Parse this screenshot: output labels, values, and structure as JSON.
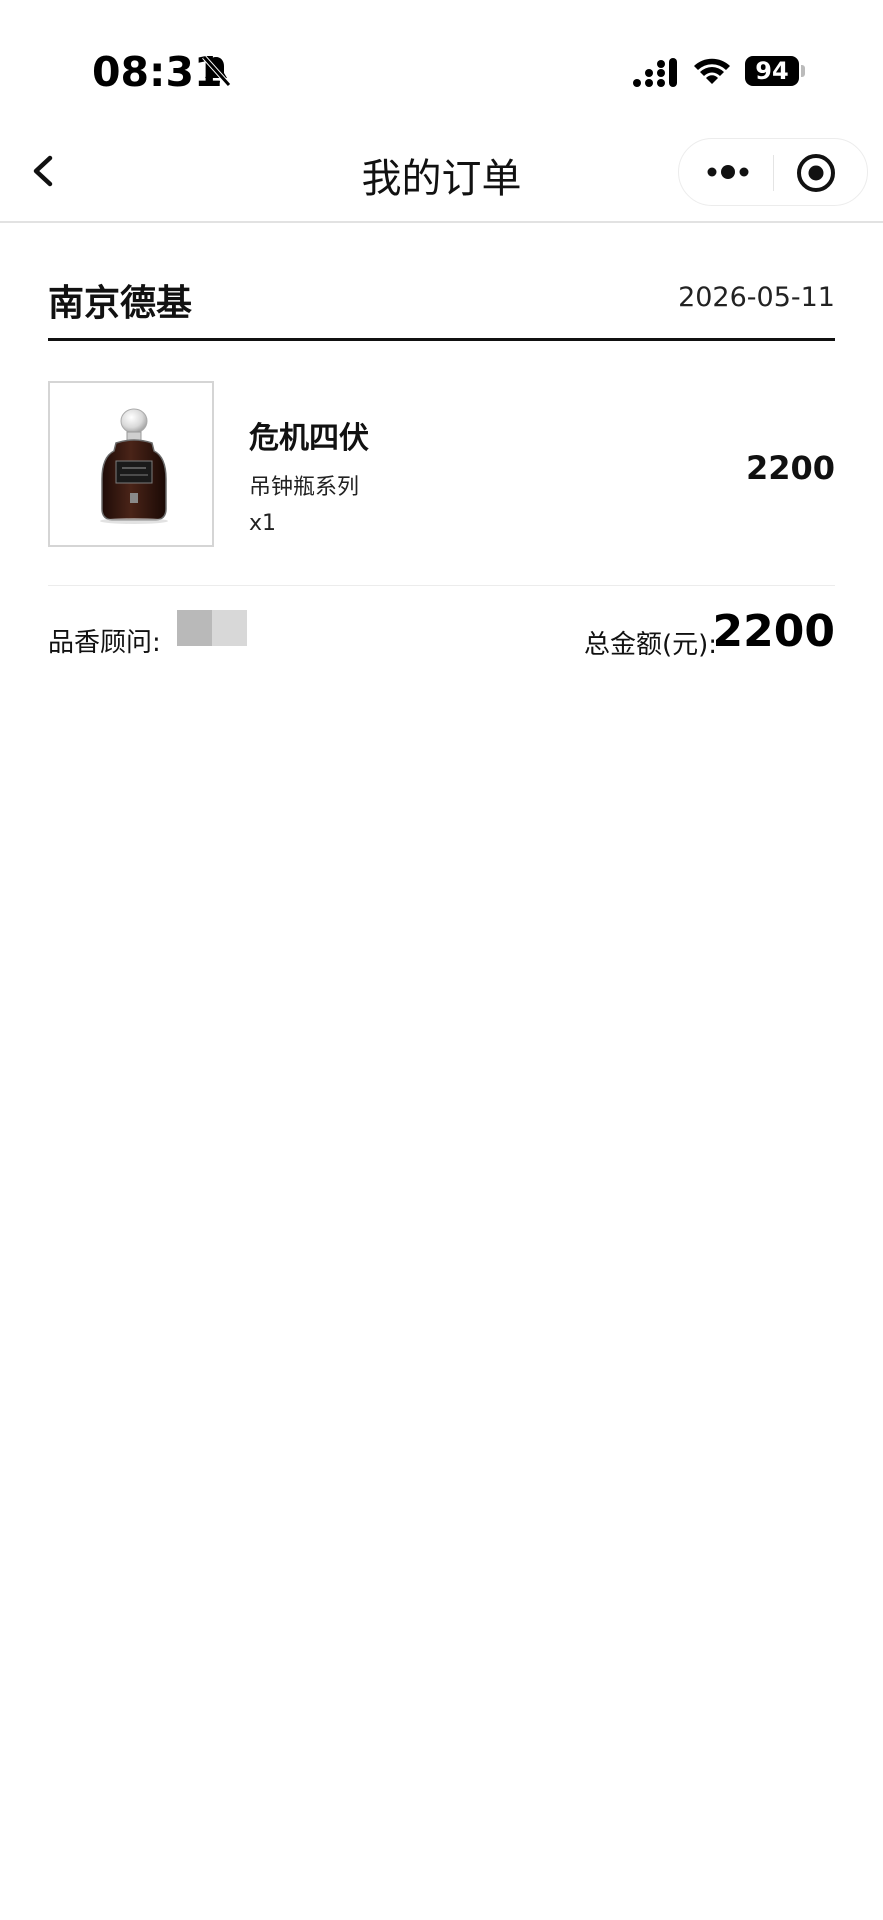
{
  "status_bar": {
    "time": "08:31",
    "battery": "94"
  },
  "nav": {
    "title": "我的订单"
  },
  "order": {
    "store": "南京德基",
    "date": "2026-05-11",
    "items": [
      {
        "name": "危机四伏",
        "series": "吊钟瓶系列",
        "quantity": "x1",
        "price": "2200",
        "image": "perfume-bottle-image"
      }
    ],
    "advisor_label": "品香顾问:",
    "total_label": "总金额(元):",
    "total_value": "2200"
  },
  "colors": {
    "text": "#111111",
    "divider": "#e2e2e2",
    "bottle_liquid": "#3a1a12"
  }
}
